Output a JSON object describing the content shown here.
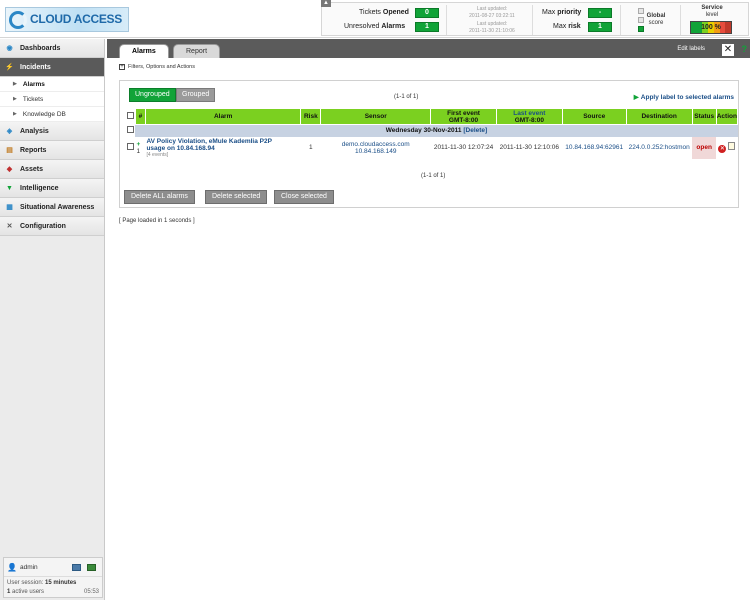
{
  "header": {
    "logo_text": "CLOUD ACCESS",
    "tickets_opened_label": "Tickets",
    "tickets_opened_label_bold": "Opened",
    "tickets_opened_value": "0",
    "unresolved_label": "Unresolved",
    "unresolved_label_bold": "Alarms",
    "unresolved_value": "1",
    "last_updated_1": "Last updated:",
    "last_updated_1_date": "2011-08-27 03:22:11",
    "last_updated_2": "Last updated:",
    "last_updated_2_date": "2011-11-30 21:10:06",
    "max_priority_label": "Max",
    "max_priority_label_bold": "priority",
    "max_priority_value": "-",
    "max_risk_label": "Max",
    "max_risk_label_bold": "risk",
    "max_risk_value": "1",
    "global_label": "Global",
    "global_score": "score",
    "service_label": "Service",
    "service_level": "level",
    "service_value": "100 %"
  },
  "sidebar": {
    "items": [
      {
        "label": "Dashboards"
      },
      {
        "label": "Incidents"
      },
      {
        "label": "Analysis"
      },
      {
        "label": "Reports"
      },
      {
        "label": "Assets"
      },
      {
        "label": "Intelligence"
      },
      {
        "label": "Situational Awareness"
      },
      {
        "label": "Configuration"
      }
    ],
    "subitems": [
      {
        "label": "Alarms"
      },
      {
        "label": "Tickets"
      },
      {
        "label": "Knowledge DB"
      }
    ],
    "user": "admin",
    "session_label": "User session:",
    "session_value": "15 minutes",
    "active_users_count": "1",
    "active_users_label": "active users",
    "time": "05:53"
  },
  "tabs": [
    {
      "label": "Alarms"
    },
    {
      "label": "Report"
    }
  ],
  "edit_labels": "Edit labels",
  "help": "?",
  "filters_label": "Filters, Options and Actions",
  "toolbar": {
    "ungrouped": "Ungrouped",
    "grouped": "Grouped",
    "pager": "(1-1 of 1)",
    "apply_label": "Apply label to selected alarms"
  },
  "table": {
    "headers": {
      "num": "#",
      "alarm": "Alarm",
      "risk": "Risk",
      "sensor": "Sensor",
      "first_event": "First event",
      "first_event_tz": "GMT-8:00",
      "last_event": "Last event",
      "last_event_tz": "GMT-8:00",
      "source": "Source",
      "destination": "Destination",
      "status": "Status",
      "action": "Action"
    },
    "day_group": "Wednesday 30-Nov-2011",
    "day_delete": "[Delete]",
    "row": {
      "num": "1",
      "alarm_line1": "AV Policy Violation, eMule Kademlia P2P",
      "alarm_line2": "usage on 10.84.168.94",
      "events": "[4 events]",
      "risk": "1",
      "sensor": "demo.cloudaccess.com 10.84.168.149",
      "first_event": "2011-11-30 12:07:24",
      "last_event": "2011-11-30 12:10:06",
      "source": "10.84.168.94:62961",
      "destination": "224.0.0.252:hostmon",
      "status": "open"
    },
    "pager_bottom": "(1-1 of 1)"
  },
  "actions": {
    "delete_all": "Delete ALL alarms",
    "delete_selected": "Delete selected",
    "close_selected": "Close selected"
  },
  "footer_text": "[ Page loaded in 1 seconds ]",
  "colors": {
    "accent_green": "#11a338",
    "header_green": "#7bd020",
    "link_blue": "#1a4e87",
    "sidebar_active": "#5a5a5a"
  }
}
